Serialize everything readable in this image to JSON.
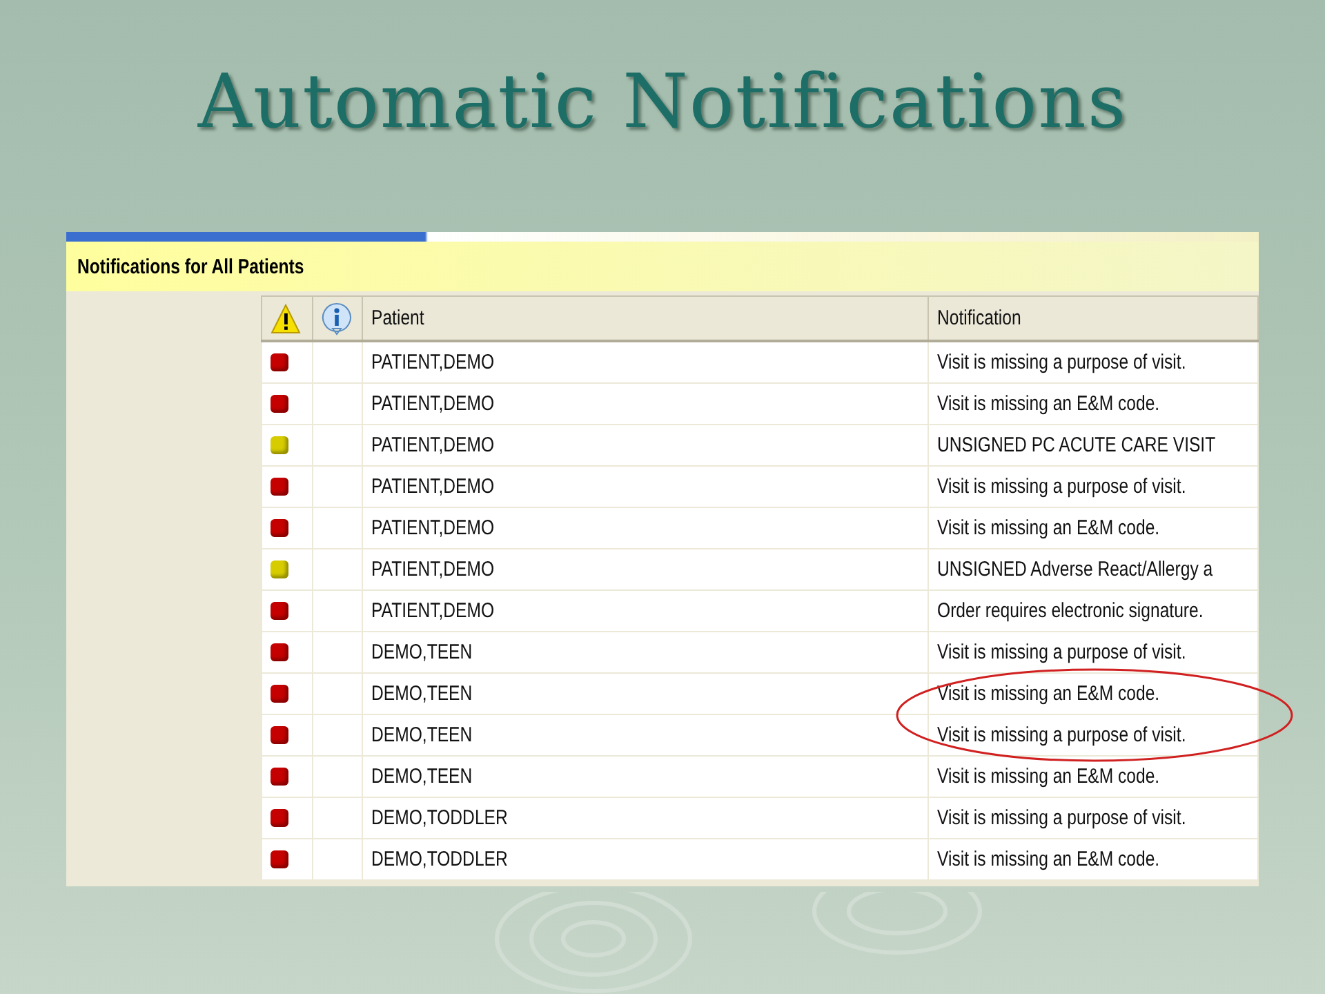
{
  "slide_title": "Automatic Notifications",
  "panel": {
    "title": "Notifications for All Patients"
  },
  "table": {
    "columns": [
      "Patient",
      "Notification"
    ],
    "rows": [
      {
        "color": "#c40000",
        "patient": "PATIENT,DEMO",
        "notification": "Visit is missing a purpose of visit."
      },
      {
        "color": "#c40000",
        "patient": "PATIENT,DEMO",
        "notification": "Visit is missing an E&M code."
      },
      {
        "color": "#d6cc00",
        "patient": "PATIENT,DEMO",
        "notification": "UNSIGNED PC ACUTE CARE VISIT"
      },
      {
        "color": "#c40000",
        "patient": "PATIENT,DEMO",
        "notification": "Visit is missing a purpose of visit."
      },
      {
        "color": "#c40000",
        "patient": "PATIENT,DEMO",
        "notification": "Visit is missing an E&M code."
      },
      {
        "color": "#d6cc00",
        "patient": "PATIENT,DEMO",
        "notification": "UNSIGNED Adverse React/Allergy a"
      },
      {
        "color": "#c40000",
        "patient": "PATIENT,DEMO",
        "notification": "Order requires electronic signature."
      },
      {
        "color": "#c40000",
        "patient": "DEMO,TEEN",
        "notification": "Visit is missing a purpose of visit."
      },
      {
        "color": "#c40000",
        "patient": "DEMO,TEEN",
        "notification": "Visit is missing an E&M code."
      },
      {
        "color": "#c40000",
        "patient": "DEMO,TEEN",
        "notification": "Visit is missing a purpose of visit."
      },
      {
        "color": "#c40000",
        "patient": "DEMO,TEEN",
        "notification": "Visit is missing an E&M code."
      },
      {
        "color": "#c40000",
        "patient": "DEMO,TODDLER",
        "notification": "Visit is missing a purpose of visit."
      },
      {
        "color": "#c40000",
        "patient": "DEMO,TODDLER",
        "notification": "Visit is missing an E&M code."
      }
    ]
  }
}
